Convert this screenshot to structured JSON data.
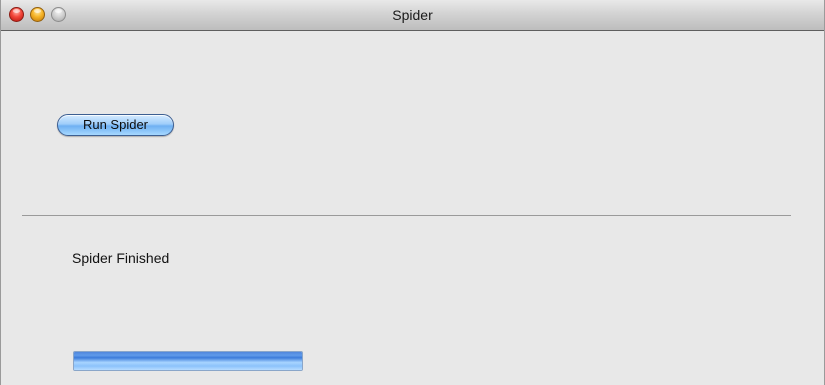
{
  "window": {
    "title": "Spider"
  },
  "controls": {
    "run_button_label": "Run Spider"
  },
  "status": {
    "text": "Spider Finished",
    "progress_percent": 100
  },
  "colors": {
    "button_accent": "#6fb0f2",
    "progress_accent": "#5f9aea",
    "close": "#f2463a",
    "minimize": "#f6b427",
    "zoom_disabled": "#cfcfcf"
  }
}
